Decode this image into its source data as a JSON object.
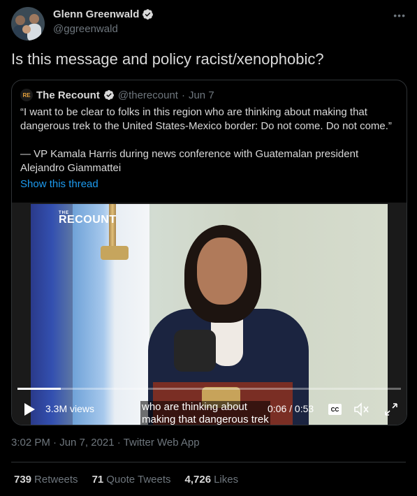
{
  "author": {
    "display_name": "Glenn Greenwald",
    "handle": "@ggreenwald",
    "verified": true,
    "more_icon": "more-icon"
  },
  "tweet": {
    "text": "Is this message and policy racist/xenophobic?"
  },
  "quoted_tweet": {
    "logo_text": "RE",
    "display_name": "The Recount",
    "handle": "@therecount",
    "separator": "·",
    "date": "Jun 7",
    "verified": true,
    "paragraphs": [
      "“I want to be clear to folks in this region who are thinking about making that dangerous trek to the United States-Mexico border: Do not come. Do not come.”",
      "— VP Kamala Harris during news conference with Guatemalan president Alejandro Giammattei"
    ],
    "show_thread": "Show this thread",
    "video": {
      "brand_small": "THE",
      "brand": "RECOUNT",
      "views": "3.3M views",
      "caption_line1": "who are thinking about",
      "caption_line2": "making that dangerous trek",
      "time": "0:06 / 0:53",
      "cc_label": "CC",
      "progress": 0.113
    }
  },
  "meta": {
    "timestamp": "3:02 PM · Jun 7, 2021 · Twitter Web App"
  },
  "stats": {
    "retweets_count": "739",
    "retweets_label": "Retweets",
    "quotes_count": "71",
    "quotes_label": "Quote Tweets",
    "likes_count": "4,726",
    "likes_label": "Likes"
  },
  "colors": {
    "background": "#000000",
    "link": "#1d9bf0",
    "verified": "#d9d9d9",
    "muted": "#6e767d",
    "border": "#2f3336"
  }
}
